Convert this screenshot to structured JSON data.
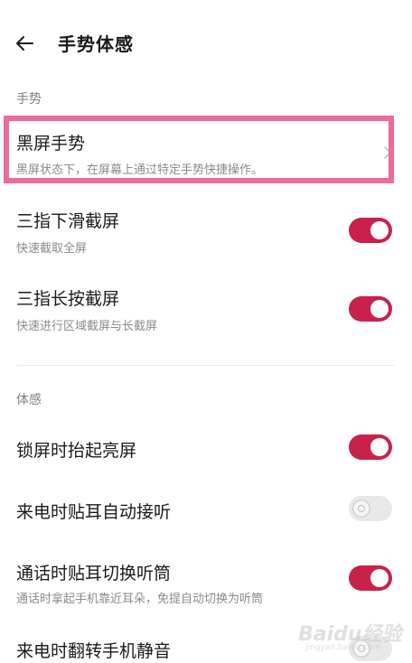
{
  "header": {
    "back_icon": "arrow-left-icon",
    "title": "手势体感"
  },
  "sections": {
    "gesture_label": "手势",
    "motion_label": "体感"
  },
  "gesture_items": [
    {
      "title": "黑屏手势",
      "subtitle": "黑屏状态下，在屏幕上通过特定手势快捷操作。",
      "control": "chevron-right-icon"
    },
    {
      "title": "三指下滑截屏",
      "subtitle": "快速截取全屏",
      "toggle": true
    },
    {
      "title": "三指长按截屏",
      "subtitle": "快速进行区域截屏与长截屏",
      "toggle": true
    }
  ],
  "motion_items": [
    {
      "title": "锁屏时抬起亮屏",
      "toggle": true
    },
    {
      "title": "来电时贴耳自动接听",
      "toggle": false
    },
    {
      "title": "通话时贴耳切换听筒",
      "subtitle": "通话时拿起手机靠近耳朵，免提自动切换为听筒",
      "toggle": true
    },
    {
      "title": "来电时翻转手机静音",
      "toggle": false
    }
  ],
  "colors": {
    "toggle_on": "#c8224a",
    "highlight_border": "#ee6c95"
  },
  "watermark": {
    "brand": "Baidu经验",
    "url": "jingyan.baidu.com"
  }
}
